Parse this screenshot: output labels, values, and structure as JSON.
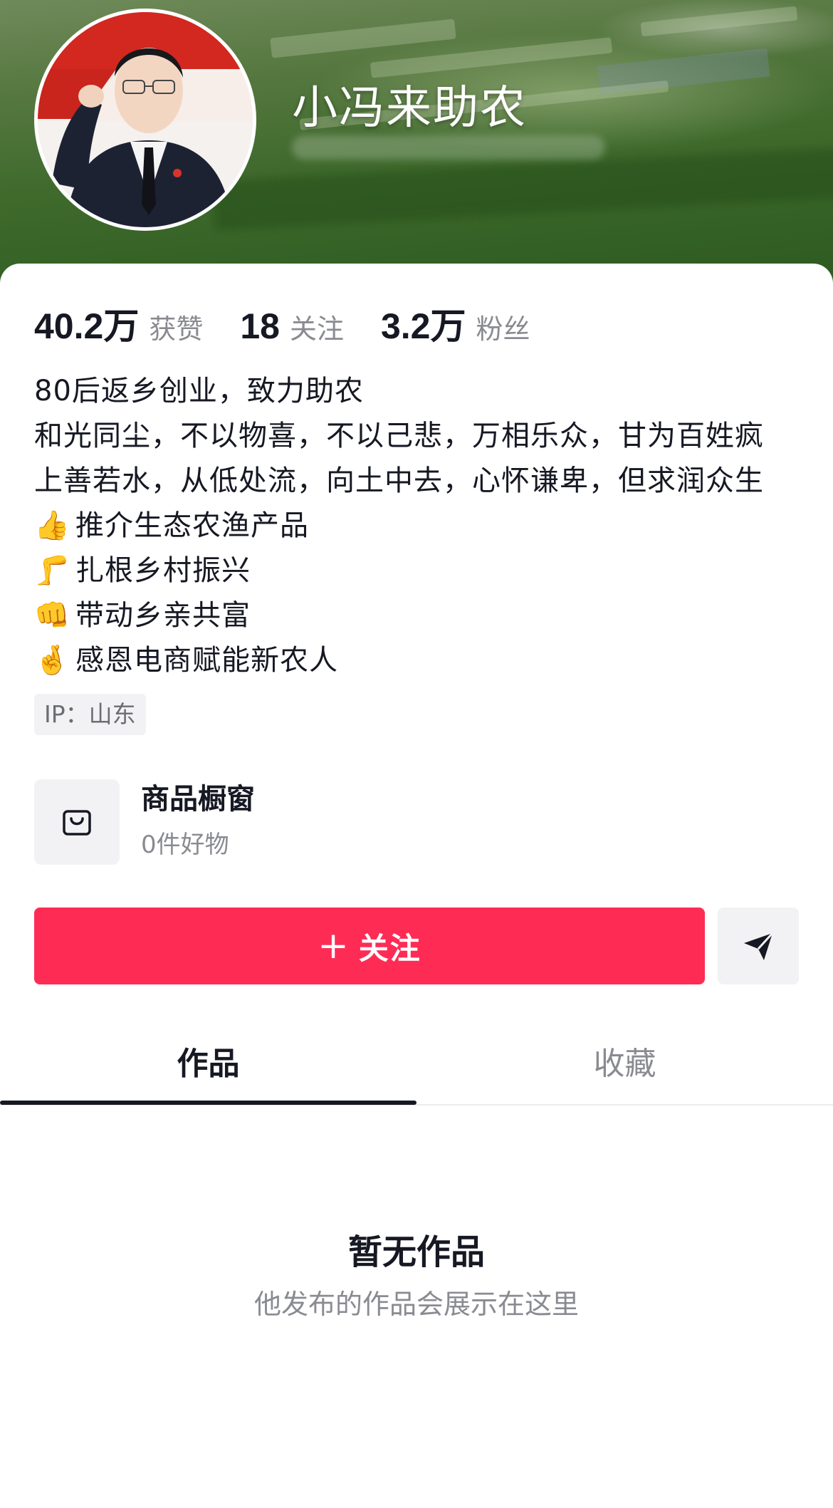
{
  "profile": {
    "username": "小冯来助农"
  },
  "stats": [
    {
      "value": "40.2万",
      "label": "获赞"
    },
    {
      "value": "18",
      "label": "关注"
    },
    {
      "value": "3.2万",
      "label": "粉丝"
    }
  ],
  "bio": {
    "line1": "80后返乡创业，致力助农",
    "line2": "和光同尘，不以物喜，不以己悲，万相乐众，甘为百姓疯",
    "line3": "上善若水，从低处流，向土中去，心怀谦卑，但求润众生",
    "line4_emoji": "👍",
    "line4": "推介生态农渔产品",
    "line5_emoji": "🦵",
    "line5": "扎根乡村振兴",
    "line6_emoji": "👊",
    "line6": "带动乡亲共富",
    "line7_emoji": "🤞",
    "line7": "感恩电商赋能新农人"
  },
  "ip": "IP：山东",
  "shop": {
    "title": "商品橱窗",
    "subtitle": "0件好物",
    "icon": "shopping-bag-icon"
  },
  "actions": {
    "follow_plus": "+",
    "follow_label": "关注",
    "message_icon": "send-icon"
  },
  "tabs": [
    {
      "label": "作品",
      "active": true
    },
    {
      "label": "收藏",
      "active": false
    }
  ],
  "empty_state": {
    "title": "暂无作品",
    "subtitle": "他发布的作品会展示在这里"
  },
  "colors": {
    "accent": "#fe2c55",
    "text_primary": "#161823",
    "text_secondary": "#8a8b91"
  }
}
